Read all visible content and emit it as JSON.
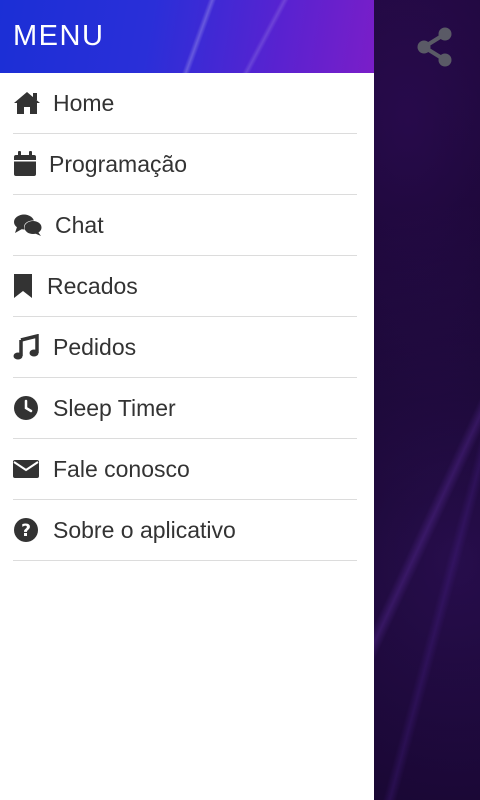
{
  "drawer": {
    "title": "MENU",
    "items": [
      {
        "label": "Home",
        "icon": "home-icon"
      },
      {
        "label": "Programação",
        "icon": "calendar-icon"
      },
      {
        "label": "Chat",
        "icon": "chat-icon"
      },
      {
        "label": "Recados",
        "icon": "bookmark-icon"
      },
      {
        "label": "Pedidos",
        "icon": "music-note-icon"
      },
      {
        "label": "Sleep Timer",
        "icon": "clock-icon"
      },
      {
        "label": "Fale conosco",
        "icon": "envelope-icon"
      },
      {
        "label": "Sobre o aplicativo",
        "icon": "help-circle-icon"
      }
    ]
  },
  "app": {
    "share_icon": "share-icon"
  },
  "colors": {
    "header_start": "#1b2fd6",
    "header_end": "#7a1ec8",
    "icon": "#333333",
    "divider": "#dcdcdc",
    "background": "#14062a"
  }
}
